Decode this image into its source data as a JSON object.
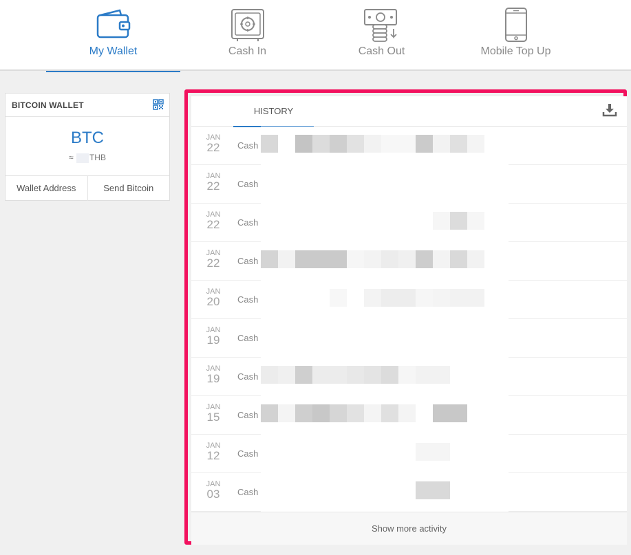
{
  "nav": {
    "items": [
      {
        "label": "My Wallet",
        "icon": "wallet-icon",
        "active": true
      },
      {
        "label": "Cash In",
        "icon": "safe-icon",
        "active": false
      },
      {
        "label": "Cash Out",
        "icon": "cash-out-icon",
        "active": false
      },
      {
        "label": "Mobile Top Up",
        "icon": "mobile-phone-icon",
        "active": false
      }
    ]
  },
  "wallet": {
    "title": "BITCOIN WALLET",
    "balance_currency": "BTC",
    "approx_symbol": "≈",
    "fiat_currency": "THB",
    "actions": {
      "address": "Wallet Address",
      "send": "Send Bitcoin"
    }
  },
  "history": {
    "tab_label": "HISTORY",
    "rows": [
      {
        "month": "JAN",
        "day": "22",
        "type": "Cash"
      },
      {
        "month": "JAN",
        "day": "22",
        "type": "Cash"
      },
      {
        "month": "JAN",
        "day": "22",
        "type": "Cash"
      },
      {
        "month": "JAN",
        "day": "22",
        "type": "Cash"
      },
      {
        "month": "JAN",
        "day": "20",
        "type": "Cash"
      },
      {
        "month": "JAN",
        "day": "19",
        "type": "Cash"
      },
      {
        "month": "JAN",
        "day": "19",
        "type": "Cash"
      },
      {
        "month": "JAN",
        "day": "15",
        "type": "Cash"
      },
      {
        "month": "JAN",
        "day": "12",
        "type": "Cash"
      },
      {
        "month": "JAN",
        "day": "03",
        "type": "Cash"
      }
    ],
    "show_more": "Show more activity"
  },
  "colors": {
    "accent": "#2b7bc7",
    "highlight_border": "#f2115e"
  }
}
